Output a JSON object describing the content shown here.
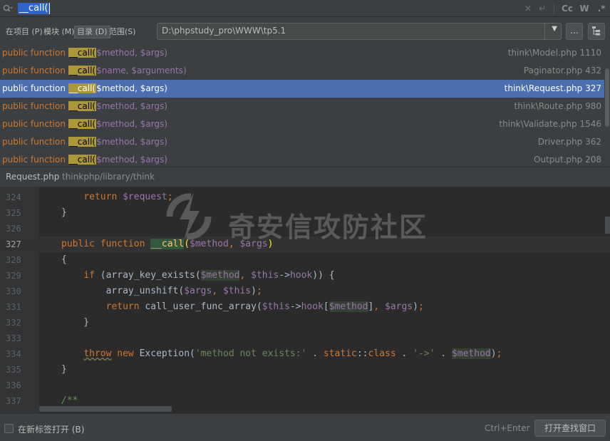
{
  "search": {
    "query": "__call(",
    "case_toggle": "Cc",
    "word_toggle": "W",
    "regex_toggle": ".*"
  },
  "scope": {
    "tabs": [
      {
        "label": "在项目 (P)",
        "active": false
      },
      {
        "label": "模块 (M)",
        "active": false
      },
      {
        "label": "目录 (D)",
        "active": true
      },
      {
        "label": "范围(S)",
        "active": false
      }
    ],
    "directory": "D:\\phpstudy_pro\\WWW\\tp5.1",
    "browse_label": "..."
  },
  "results": [
    {
      "keyword": "public function",
      "match": "__call(",
      "params": "$method, $args)",
      "file": "think\\Model.php 1110"
    },
    {
      "keyword": "public function",
      "match": "__call(",
      "params": "$name, $arguments)",
      "file": "Paginator.php 432"
    },
    {
      "keyword": "public function",
      "match": "__call(",
      "params": "$method, $args)",
      "file": "think\\Request.php 327",
      "selected": true
    },
    {
      "keyword": "public function",
      "match": "__call(",
      "params": "$method, $args)",
      "file": "think\\Route.php 980"
    },
    {
      "keyword": "public function",
      "match": "__call(",
      "params": "$method, $args)",
      "file": "think\\Validate.php 1546"
    },
    {
      "keyword": "public function",
      "match": "__call(",
      "params": "$method, $args)",
      "file": "Driver.php 362"
    },
    {
      "keyword": "public function",
      "match": "__call(",
      "params": "$method, $args)",
      "file": "Output.php 208"
    }
  ],
  "preview": {
    "file_name": "Request.php",
    "file_path": "thinkphp/library/think"
  },
  "editor": {
    "current_line": 327,
    "line_numbers": [
      "324",
      "325",
      "326",
      "327",
      "328",
      "329",
      "330",
      "331",
      "332",
      "333",
      "334",
      "335",
      "336",
      "337"
    ]
  },
  "watermark": "奇安信攻防社区",
  "footer": {
    "open_new_tab_label": "在新标签打开 (B)",
    "shortcut": "Ctrl+Enter",
    "open_find_window_label": "打开查找窗口"
  },
  "colors": {
    "background": "#2b2b2b",
    "panel": "#3c3f41",
    "selection": "#4b6eaf",
    "keyword": "#cc7832",
    "variable": "#9876aa",
    "function": "#ffc66d",
    "string": "#6a8759",
    "match_highlight": "#ac9739"
  }
}
